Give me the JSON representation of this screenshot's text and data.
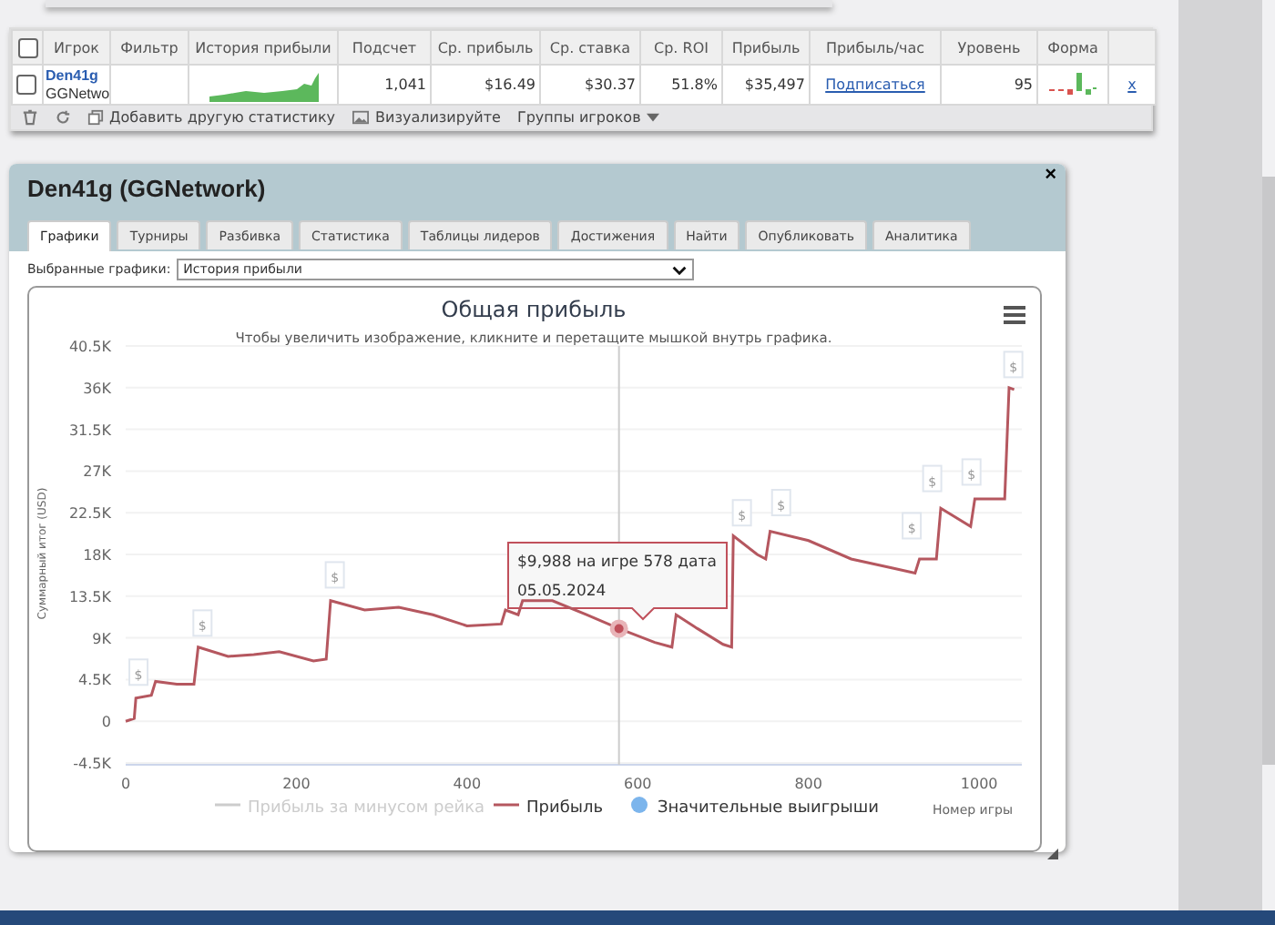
{
  "stats_table": {
    "select_all_checked": false,
    "columns": [
      "Игрок",
      "Фильтр",
      "История прибыли",
      "Подсчет",
      "Ср. прибыль",
      "Ср. ставка",
      "Ср. ROI",
      "Прибыль",
      "Прибыль/час",
      "Уровень",
      "Форма"
    ],
    "rows": [
      {
        "checked": false,
        "player": "Den41g",
        "network": "GGNetwo",
        "count": "1,041",
        "avg_profit": "$16.49",
        "avg_stake": "$30.37",
        "avg_roi": "51.8%",
        "profit": "$35,497",
        "profit_per_hour": "Подписаться",
        "level": "95",
        "remove": "x"
      }
    ],
    "toolbar": [
      {
        "kind": "delete"
      },
      {
        "kind": "refresh"
      },
      {
        "kind": "add",
        "label": "Добавить другую статистику"
      },
      {
        "kind": "visualize",
        "label": "Визуализируйте"
      },
      {
        "kind": "menu",
        "label": "Группы игроков"
      }
    ]
  },
  "popup": {
    "title": "Den41g (GGNetwork)",
    "close": "×",
    "tabs": [
      {
        "label": "Графики",
        "selected": true
      },
      {
        "label": "Турниры",
        "selected": false
      },
      {
        "label": "Разбивка",
        "selected": false
      },
      {
        "label": "Статистика",
        "selected": false
      },
      {
        "label": "Таблицы лидеров",
        "selected": false
      },
      {
        "label": "Достижения",
        "selected": false
      },
      {
        "label": "Найти",
        "selected": false
      },
      {
        "label": "Опубликовать",
        "selected": false
      },
      {
        "label": "Аналитика",
        "selected": false
      }
    ],
    "chart_select": {
      "label": "Выбранные графики:",
      "value": "История прибыли"
    },
    "chart": {
      "subtitle": "Чтобы увеличить изображение, кликните и перетащите мышкой внутрь графика.",
      "tooltip": [
        "$9,988 на игре 578 дата",
        "05.05.2024"
      ],
      "legend": [
        {
          "label": "Прибыль за минусом рейка",
          "kind": "line",
          "visible": false,
          "color": "#cccccc"
        },
        {
          "kind": "series"
        },
        {
          "label": "Значительные выигрыши",
          "kind": "dot",
          "visible": true,
          "color": "#7cb5ec"
        }
      ],
      "flags": [
        "$",
        "$",
        "$",
        "$",
        "$",
        "$",
        "$",
        "$",
        "$"
      ],
      "chart_data": {
        "type": "line",
        "grid": true,
        "ref_lines": [
          {
            "axis": "x",
            "value": 578
          }
        ],
        "title": "Общая прибыль",
        "xlabel": "Номер игры",
        "ylabel": "Суммарный итог (USD)",
        "x": [
          0,
          10,
          12,
          30,
          35,
          60,
          80,
          85,
          120,
          150,
          180,
          220,
          235,
          240,
          280,
          320,
          360,
          400,
          440,
          445,
          460,
          465,
          500,
          540,
          578,
          620,
          640,
          645,
          670,
          700,
          710,
          712,
          740,
          750,
          755,
          800,
          850,
          900,
          925,
          930,
          950,
          955,
          990,
          995,
          1030,
          1035,
          1041
        ],
        "series": [
          {
            "name": "Прибыль",
            "color": "#b5575f",
            "values": [
              0,
              0.3,
              2.5,
              2.8,
              4.3,
              4.0,
              4.0,
              8.0,
              7.0,
              7.2,
              7.5,
              6.5,
              6.7,
              13.0,
              12.0,
              12.3,
              11.5,
              10.3,
              10.5,
              12.0,
              11.5,
              13.0,
              13.0,
              11.5,
              10.0,
              8.5,
              8.0,
              11.5,
              10.0,
              8.3,
              8.0,
              20.0,
              18.0,
              17.5,
              20.5,
              19.5,
              17.5,
              16.5,
              16.0,
              17.5,
              17.5,
              23.0,
              21.0,
              24.0,
              24.0,
              36.0,
              35.8
            ]
          }
        ],
        "xlim": [
          0,
          1050
        ],
        "ylim": [
          -4.5,
          40.5
        ],
        "xticks": [
          0,
          200,
          400,
          600,
          800,
          1000
        ],
        "yticks": [
          {
            "value": -4.5,
            "label": "-4.5K"
          },
          {
            "value": 0,
            "label": "0"
          },
          {
            "value": 4.5,
            "label": "4.5K"
          },
          {
            "value": 9,
            "label": "9K"
          },
          {
            "value": 13.5,
            "label": "13.5K"
          },
          {
            "value": 18,
            "label": "18K"
          },
          {
            "value": 22.5,
            "label": "22.5K"
          },
          {
            "value": 27,
            "label": "27K"
          },
          {
            "value": 31.5,
            "label": "31.5K"
          },
          {
            "value": 36,
            "label": "36K"
          },
          {
            "value": 40.5,
            "label": "40.5K"
          }
        ]
      }
    }
  }
}
